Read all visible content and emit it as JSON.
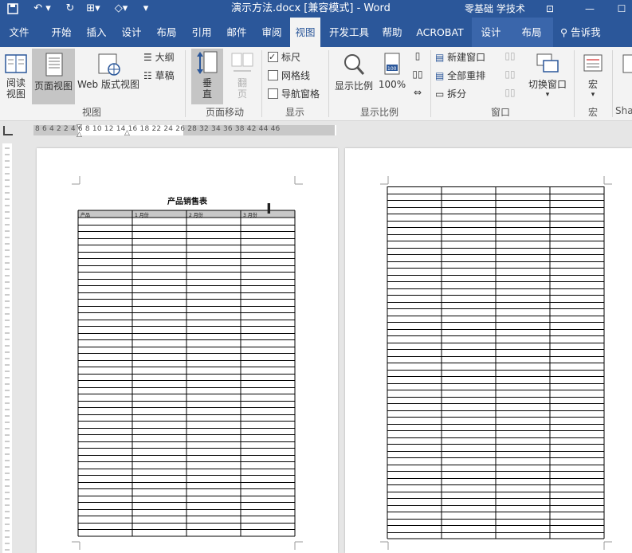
{
  "titlebar": {
    "doc_title": "演示方法.docx [兼容模式]  -  Word",
    "account": "零基础 学技术",
    "qat": [
      "save-icon",
      "undo-icon",
      "redo-icon",
      "insert-icon",
      "shape-icon",
      "customize-icon"
    ]
  },
  "tabs": [
    "文件",
    "开始",
    "插入",
    "设计",
    "布局",
    "引用",
    "邮件",
    "审阅",
    "视图",
    "开发工具",
    "帮助",
    "ACROBAT",
    "设计",
    "布局"
  ],
  "active_tab": "视图",
  "tell_me": "告诉我",
  "ribbon": {
    "views": {
      "read_mode": "阅读\n视图",
      "print_layout": "页面视图",
      "web_layout": "Web 版式视图",
      "outline": "大纲",
      "draft": "草稿",
      "group": "视图"
    },
    "page_movement": {
      "vertical": "垂\n直",
      "side_to_side": "翻\n页",
      "group": "页面移动"
    },
    "show": {
      "ruler": "标尺",
      "ruler_checked": true,
      "gridlines": "网格线",
      "gridlines_checked": false,
      "nav_pane": "导航窗格",
      "nav_pane_checked": false,
      "group": "显示"
    },
    "zoom": {
      "zoom": "显示比例",
      "hundred": "100%",
      "group": "显示比例"
    },
    "window": {
      "new_window": "新建窗口",
      "arrange_all": "全部重排",
      "split": "拆分",
      "switch_windows": "切换窗口",
      "group": "窗口"
    },
    "macros": {
      "macros": "宏",
      "group": "宏"
    },
    "sharepoint": {
      "group": "Sha"
    }
  },
  "ruler": {
    "numbers": "8  6  4  2     2   4   6   8   10  12  14  16  18     22  24  26  28     32  34  36  38     42  44  46"
  },
  "document": {
    "table_title": "产品销售表",
    "headers": [
      "产品",
      "1 月份",
      "2 月份",
      "3 月份"
    ]
  }
}
